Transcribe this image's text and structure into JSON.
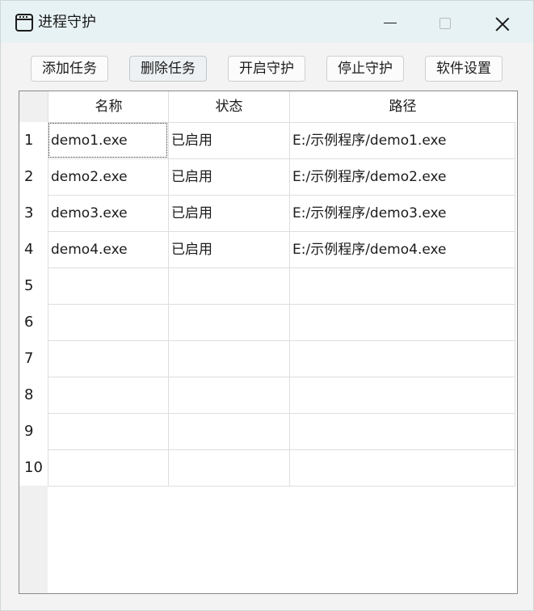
{
  "window": {
    "title": "进程守护",
    "controls": [
      "minimize-icon",
      "maximize-icon",
      "close-icon"
    ]
  },
  "toolbar": {
    "add_task": "添加任务",
    "delete_task": "删除任务",
    "start_guard": "开启守护",
    "stop_guard": "停止守护",
    "settings": "软件设置"
  },
  "table": {
    "columns": [
      "名称",
      "状态",
      "路径"
    ],
    "rows": [
      {
        "num": "1",
        "name": "demo1.exe",
        "status": "已启用",
        "path": "E:/示例程序/demo1.exe"
      },
      {
        "num": "2",
        "name": "demo2.exe",
        "status": "已启用",
        "path": "E:/示例程序/demo2.exe"
      },
      {
        "num": "3",
        "name": "demo3.exe",
        "status": "已启用",
        "path": "E:/示例程序/demo3.exe"
      },
      {
        "num": "4",
        "name": "demo4.exe",
        "status": "已启用",
        "path": "E:/示例程序/demo4.exe"
      },
      {
        "num": "5",
        "name": "",
        "status": "",
        "path": ""
      },
      {
        "num": "6",
        "name": "",
        "status": "",
        "path": ""
      },
      {
        "num": "7",
        "name": "",
        "status": "",
        "path": ""
      },
      {
        "num": "8",
        "name": "",
        "status": "",
        "path": ""
      },
      {
        "num": "9",
        "name": "",
        "status": "",
        "path": ""
      },
      {
        "num": "10",
        "name": "",
        "status": "",
        "path": ""
      }
    ]
  }
}
